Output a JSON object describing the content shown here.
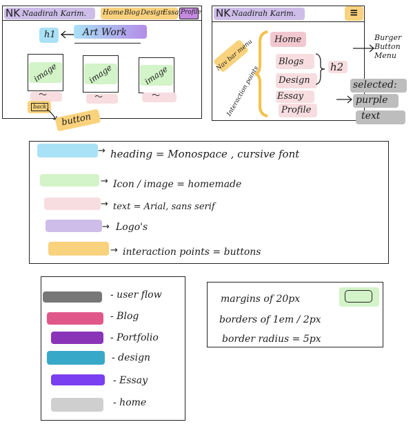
{
  "wireframe_desktop": {
    "logo": "NK",
    "brand": "Naadirah Karim.",
    "nav": [
      "Home",
      "Blog",
      "Design",
      "Essay",
      "Profile"
    ],
    "heading": "h1",
    "art_work": "Art Work",
    "image_label": "image",
    "back": "back",
    "button_note": "button"
  },
  "wireframe_mobile": {
    "logo": "NK",
    "brand": "Naadirah Karim.",
    "nav_bar_menu": "Nav bar menu",
    "interaction_points": "Interaction points",
    "menu_items": [
      "Home",
      "Blogs",
      "Design",
      "Essay",
      "Profile"
    ],
    "h2": "h2",
    "burger_note": "Burger Button Menu",
    "selected": "selected:",
    "purple": "purple",
    "text": "text"
  },
  "legend_top": [
    {
      "color": "#a9e1f6",
      "label": "heading = Monospace , cursive font"
    },
    {
      "color": "#d3f3c8",
      "label": "Icon / image = homemade"
    },
    {
      "color": "#f7dde0",
      "label": "text = Arial, sans serif"
    },
    {
      "color": "#cdbde8",
      "label": "Logo's"
    },
    {
      "color": "#f9d27d",
      "label": "interaction points = buttons"
    }
  ],
  "legend_colors": [
    {
      "color": "#777777",
      "label": "- user flow"
    },
    {
      "color": "#e0588a",
      "label": "- Blog"
    },
    {
      "color": "#8a35b8",
      "label": "- Portfolio"
    },
    {
      "color": "#38a8c8",
      "label": "- design"
    },
    {
      "color": "#7a3ff0",
      "label": "- Essay"
    },
    {
      "color": "#cfcfcf",
      "label": "- home"
    }
  ],
  "specs": {
    "margins": "margins of 20px",
    "borders": "borders of 1em / 2px",
    "radius": "border radius = 5px"
  }
}
